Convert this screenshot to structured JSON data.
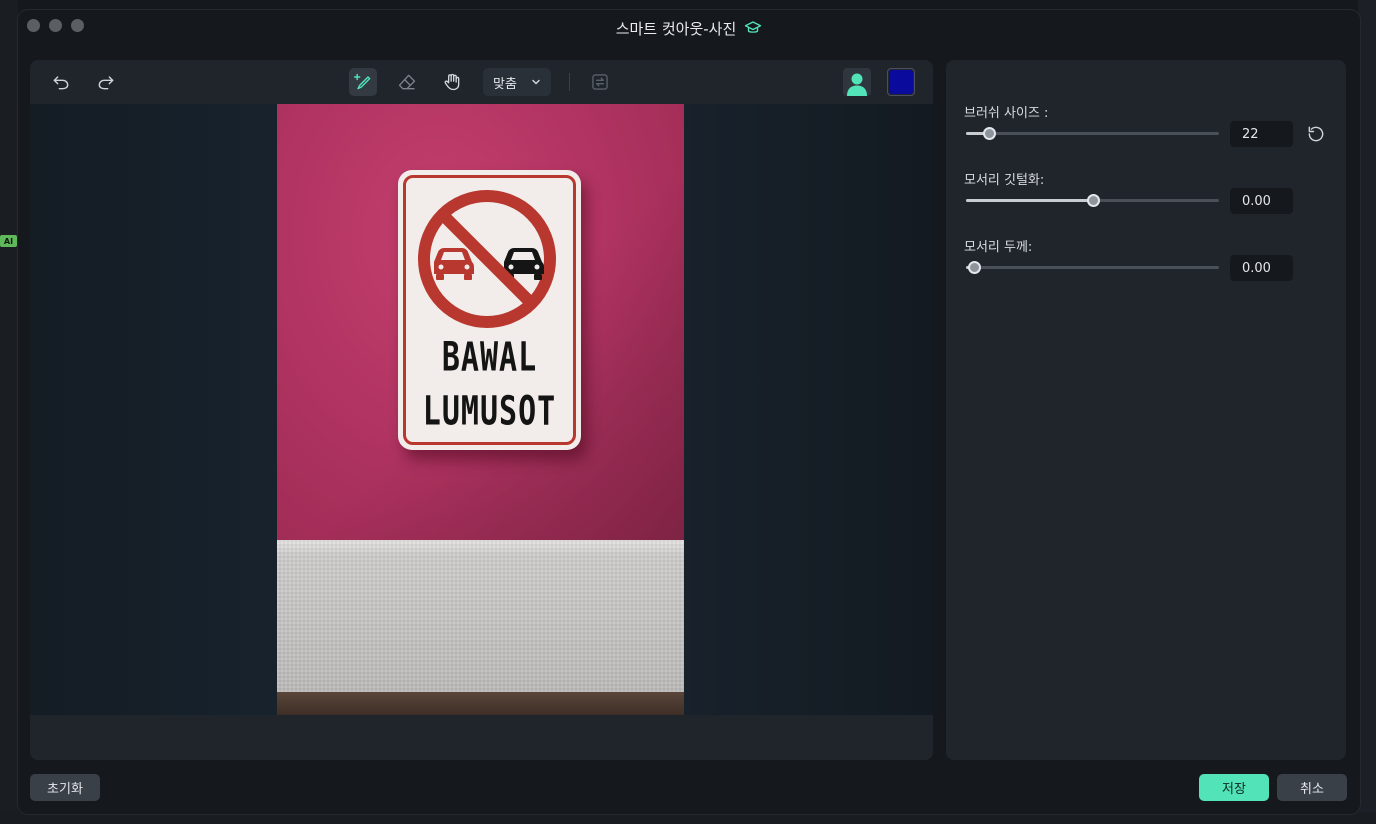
{
  "window": {
    "title": "스마트 컷아웃-사진"
  },
  "toolbar": {
    "undo_icon": "undo-icon",
    "redo_icon": "redo-icon",
    "brush_icon": "add-brush-icon",
    "eraser_icon": "eraser-icon",
    "hand_icon": "hand-pan-icon",
    "fit_select_value": "맞춤",
    "swap_icon": "swap-icon",
    "person_icon": "person-preview-icon",
    "color_value": "#0a0a9c"
  },
  "image": {
    "sign_line1": "BAWAL",
    "sign_line2": "LUMUSOT"
  },
  "panel": {
    "brush_size": {
      "label": "브러쉬 사이즈 :",
      "value": "22",
      "fraction": 0.09
    },
    "edge_feather": {
      "label": "모서리 깃털화:",
      "value": "0.00",
      "fraction": 0.5
    },
    "edge_thickness": {
      "label": "모서리 두께:",
      "value": "0.00",
      "fraction": 0.03
    }
  },
  "footer": {
    "reset_label": "초기화",
    "save_label": "저장",
    "cancel_label": "취소"
  },
  "colors": {
    "accent": "#52e3b8",
    "wall": "#b23462",
    "sign_red": "#b8372e"
  },
  "background": {
    "ai_badge": "AI"
  }
}
